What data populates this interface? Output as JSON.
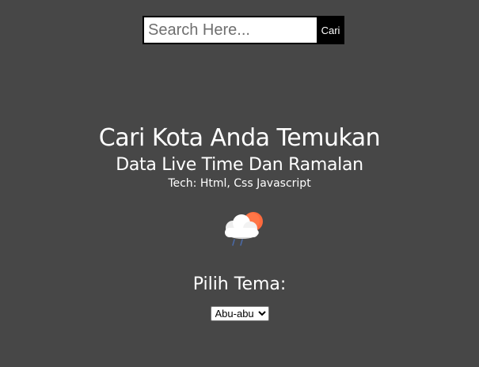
{
  "search": {
    "placeholder": "Search Here...",
    "button_label": "Cari"
  },
  "hero": {
    "title": "Cari Kota Anda Temukan",
    "subtitle": "Data Live Time Dan Ramalan",
    "tech": "Tech: Html, Css Javascript"
  },
  "weather": {
    "icon": "cloud-sun-rain-icon",
    "colors": {
      "sun": "#ff6a3d",
      "cloud": "#ffffff",
      "cloud_shadow": "#d9d9d9",
      "rain": "#4a6aa8"
    }
  },
  "theme": {
    "label": "Pilih Tema:",
    "selected": "Abu-abu"
  },
  "colors": {
    "background": "#474747",
    "text": "#ffffff",
    "button": "#000000"
  }
}
